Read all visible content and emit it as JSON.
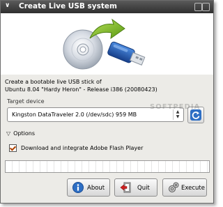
{
  "window": {
    "title": "Create Live USB system"
  },
  "description": {
    "line1": "Create a bootable live USB stick of",
    "line2": "Ubuntu 8.04 \"Hardy Heron\" - Release i386 (20080423)"
  },
  "target_device": {
    "label": "Target device",
    "selected": "Kingston DataTraveler 2.0 (/dev/sdc) 959 MB"
  },
  "options": {
    "label": "Options",
    "flash_checkbox": {
      "label": "Download and integrate Adobe Flash Player",
      "checked": true
    }
  },
  "progress": {
    "fraction": 0
  },
  "buttons": {
    "about": "About",
    "quit": "Quit",
    "execute": "Execute"
  },
  "watermark": "SOFTPEDIA",
  "colors": {
    "titlebar": "#3f3f3f",
    "window_bg": "#ecebe7",
    "accent_blue": "#2e6fc4",
    "check_mark": "#b14400"
  },
  "icons": {
    "window_menu": "chevron-down-icon",
    "refresh": "refresh-icon",
    "about": "info-icon",
    "quit": "quit-icon",
    "execute": "execute-icon",
    "hero": "cd-to-usb-icon"
  }
}
